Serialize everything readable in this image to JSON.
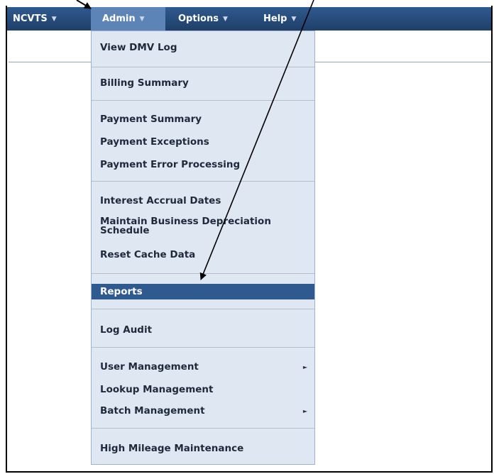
{
  "menubar": {
    "items": [
      {
        "label": "NCVTS",
        "caret": "▼"
      },
      {
        "label": "Admin",
        "caret": "▼"
      },
      {
        "label": "Options",
        "caret": "▼"
      },
      {
        "label": "Help",
        "caret": "▼"
      }
    ],
    "active": "Admin",
    "bg_color": "#2f5a8f"
  },
  "admin_menu": {
    "items": [
      "View DMV Log",
      "Billing Summary",
      "Payment Summary",
      "Payment Exceptions",
      "Payment Error Processing",
      "Interest Accrual Dates",
      "Maintain Business Depreciation Schedule",
      "Reset Cache Data",
      "Reports",
      "Log Audit",
      "User Management",
      "Lookup Management",
      "Batch Management",
      "High Mileage Maintenance"
    ],
    "selected": "Reports",
    "submenu_arrow": "►",
    "bg_color": "#dfe7f2",
    "selected_color": "#2f5a8f"
  }
}
